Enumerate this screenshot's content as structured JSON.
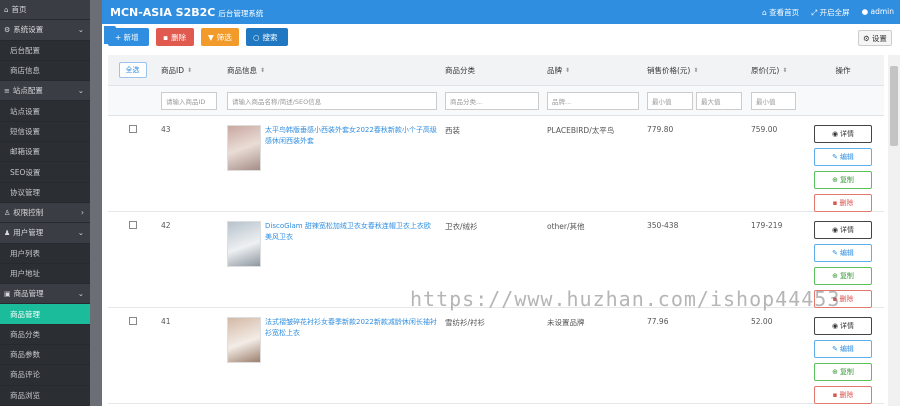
{
  "sidebar": {
    "items": [
      {
        "label": "首页",
        "icon": "home-icon",
        "type": "group"
      },
      {
        "label": "系统设置",
        "icon": "gear-icon",
        "type": "group",
        "arrow": "⌄"
      },
      {
        "label": "后台配置",
        "type": "sub"
      },
      {
        "label": "商店信息",
        "type": "sub"
      },
      {
        "label": "站点配置",
        "icon": "list-icon",
        "type": "group",
        "arrow": "⌄"
      },
      {
        "label": "站点设置",
        "type": "sub"
      },
      {
        "label": "短信设置",
        "type": "sub"
      },
      {
        "label": "邮箱设置",
        "type": "sub"
      },
      {
        "label": "SEO设置",
        "type": "sub"
      },
      {
        "label": "协议管理",
        "type": "sub"
      },
      {
        "label": "权限控制",
        "icon": "user-icon",
        "type": "group",
        "arrow": "›"
      },
      {
        "label": "用户管理",
        "icon": "users-icon",
        "type": "group",
        "arrow": "⌄"
      },
      {
        "label": "用户列表",
        "type": "sub"
      },
      {
        "label": "用户地址",
        "type": "sub"
      },
      {
        "label": "商品管理",
        "icon": "box-icon",
        "type": "group",
        "arrow": "⌄"
      },
      {
        "label": "商品管理",
        "type": "sub",
        "active": true
      },
      {
        "label": "商品分类",
        "type": "sub"
      },
      {
        "label": "商品参数",
        "type": "sub"
      },
      {
        "label": "商品评论",
        "type": "sub"
      },
      {
        "label": "商品浏览",
        "type": "sub"
      }
    ]
  },
  "header": {
    "brand": "MCN-ASIA S2B2C",
    "brand_sub": "后台管理系统",
    "home_link": "查看首页",
    "fullscreen": "开启全屏",
    "user": "admin"
  },
  "toolbar": {
    "add": "+ 新增",
    "delete": "删除",
    "filter": "筛选",
    "search": "搜索",
    "settings": "设置"
  },
  "table": {
    "all_btn": "全选",
    "headers": {
      "id": "商品ID",
      "info": "商品信息",
      "category": "商品分类",
      "brand": "品牌",
      "price": "销售价格(元)",
      "original": "原价(元)",
      "ops": "操作"
    },
    "filters": {
      "id": "请输入商品ID",
      "info": "请输入商品名称/简述/SEO信息",
      "category": "商品分类...",
      "brand": "品牌...",
      "price_min": "最小值",
      "price_max": "最大值",
      "orig_min": "最小值"
    },
    "rows": [
      {
        "id": "43",
        "title": "太平鸟韩版垂感小西装外套女2022春秋新款小个子高级感休闲西装外套",
        "category": "西装",
        "brand": "PLACEBIRD/太平鸟",
        "price": "779.80",
        "original": "759.00"
      },
      {
        "id": "42",
        "title": "DiscoGlam 甜辣宽松加绒卫衣女春秋连帽卫衣上衣欧美风卫衣",
        "category": "卫衣/绒衫",
        "brand": "other/其他",
        "price": "350-438",
        "original": "179-219"
      },
      {
        "id": "41",
        "title": "法式褶皱碎花衬衫女春季新款2022新款减龄休闲长袖衬衫宽松上衣",
        "category": "雪纺衫/衬衫",
        "brand": "未设置品牌",
        "price": "77.96",
        "original": "52.00"
      }
    ],
    "ops": {
      "detail": "详情",
      "edit": "编辑",
      "copy": "复制",
      "delete": "删除"
    }
  },
  "watermark": "https://www.huzhan.com/ishop44453"
}
